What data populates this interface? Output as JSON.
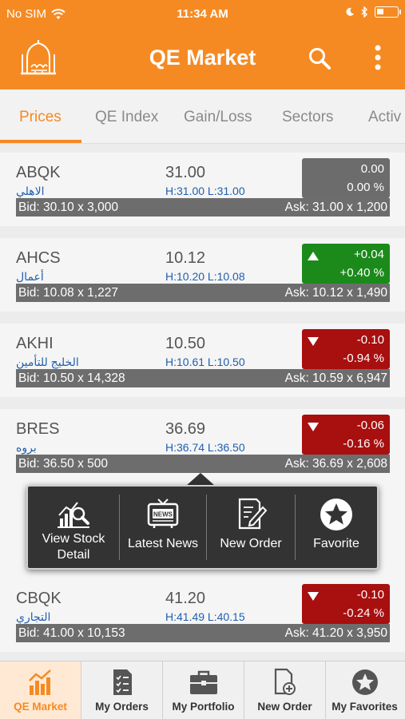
{
  "status_bar": {
    "carrier": "No SIM",
    "time": "11:34 AM"
  },
  "header": {
    "title": "QE Market"
  },
  "tabs": [
    {
      "label": "Prices",
      "active": true
    },
    {
      "label": "QE Index"
    },
    {
      "label": "Gain/Loss"
    },
    {
      "label": "Sectors"
    },
    {
      "label": "Activ"
    }
  ],
  "stocks": [
    {
      "symbol": "ABQK",
      "name_ar": "الاهلي",
      "price": "31.00",
      "high_low": "H:31.00 L:31.00",
      "change": "0.00",
      "change_pct": "0.00 %",
      "direction": "neutral",
      "bid": "Bid: 30.10  x  3,000",
      "ask": "Ask: 31.00  x  1,200"
    },
    {
      "symbol": "AHCS",
      "name_ar": "أعمال",
      "price": "10.12",
      "high_low": "H:10.20 L:10.08",
      "change": "+0.04",
      "change_pct": "+0.40 %",
      "direction": "up",
      "bid": "Bid: 10.08  x  1,227",
      "ask": "Ask: 10.12  x  1,490"
    },
    {
      "symbol": "AKHI",
      "name_ar": "الخليج للتأمين",
      "price": "10.50",
      "high_low": "H:10.61 L:10.50",
      "change": "-0.10",
      "change_pct": "-0.94 %",
      "direction": "down",
      "bid": "Bid: 10.50  x  14,328",
      "ask": "Ask: 10.59  x  6,947"
    },
    {
      "symbol": "BRES",
      "name_ar": "بروه",
      "price": "36.69",
      "high_low": "H:36.74 L:36.50",
      "change": "-0.06",
      "change_pct": "-0.16 %",
      "direction": "down",
      "bid": "Bid: 36.50  x  500",
      "ask": "Ask: 36.69  x  2,608"
    },
    {
      "symbol": "CBQK",
      "name_ar": "التجاري",
      "price": "41.20",
      "high_low": "H:41.49 L:40.15",
      "change": "-0.10",
      "change_pct": "-0.24 %",
      "direction": "down",
      "bid": "Bid: 41.00  x  10,153",
      "ask": "Ask: 41.20  x  3,950"
    }
  ],
  "popup": {
    "view_detail_line1": "View Stock",
    "view_detail_line2": "Detail",
    "latest_news": "Latest News",
    "new_order": "New Order",
    "favorite": "Favorite",
    "news_icon_text": "NEWS"
  },
  "bottom_nav": [
    {
      "label": "QE Market",
      "active": true
    },
    {
      "label": "My Orders"
    },
    {
      "label": "My Portfolio"
    },
    {
      "label": "New Order"
    },
    {
      "label": "My Favorites"
    }
  ],
  "colors": {
    "brand": "#f68a22",
    "up": "#1b8a1b",
    "down": "#a80f0f",
    "neutral": "#6c6c6c",
    "link": "#1f5fae"
  }
}
